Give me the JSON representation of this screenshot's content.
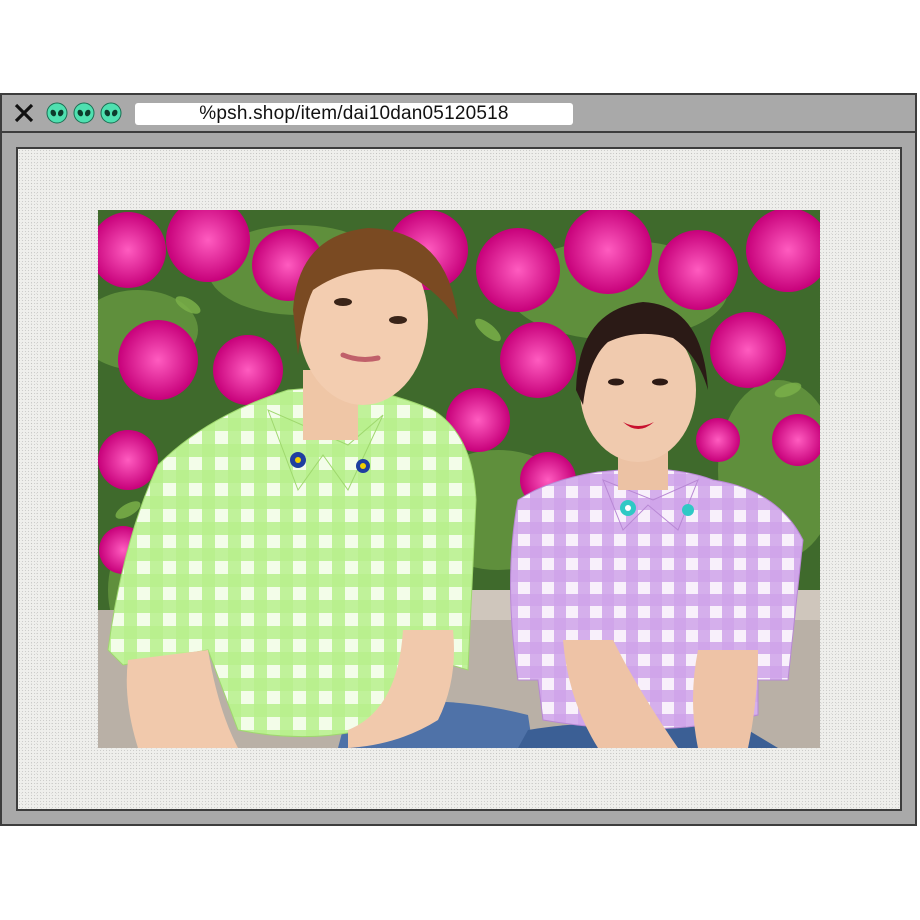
{
  "window": {
    "url": "%psh.shop/item/dai10dan05120518",
    "icons": {
      "close": "close-icon",
      "alien": "alien-icon"
    }
  },
  "colors": {
    "chrome": "#a9a9a9",
    "border": "#3d3d3d",
    "alien_fill": "#4fe0b0",
    "canvas": "#efefec",
    "flowers": "#e2148a",
    "green_shirt": "#a8ec7c",
    "purple_shirt": "#c898e0"
  },
  "photo": {
    "subject": "photo"
  }
}
